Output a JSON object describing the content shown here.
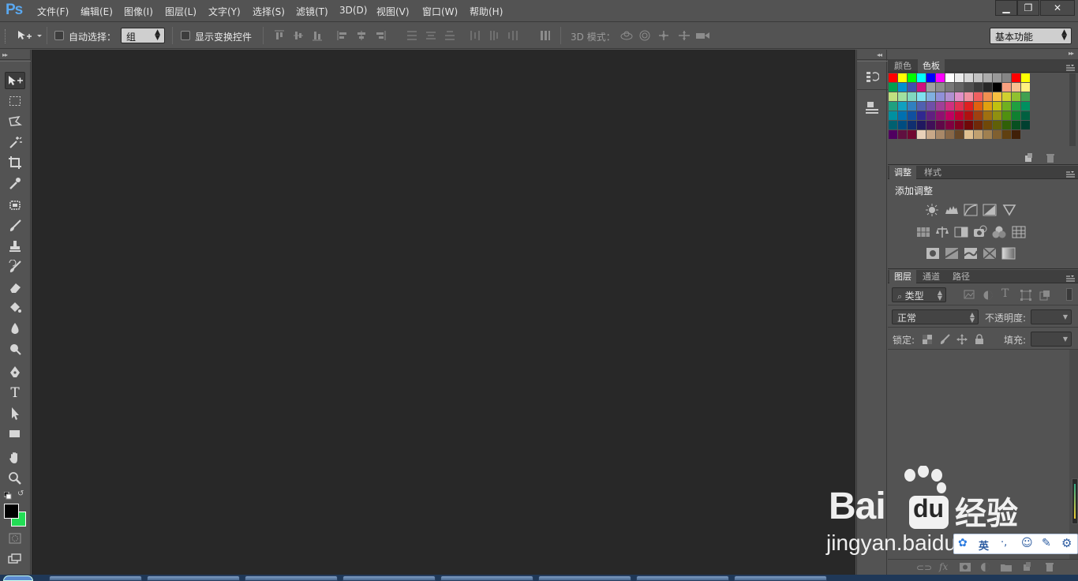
{
  "app": {
    "logo": "Ps"
  },
  "menu": {
    "items": [
      "文件(F)",
      "编辑(E)",
      "图像(I)",
      "图层(L)",
      "文字(Y)",
      "选择(S)",
      "滤镜(T)",
      "3D(D)",
      "视图(V)",
      "窗口(W)",
      "帮助(H)"
    ]
  },
  "window_controls": {
    "minimize": "▁",
    "restore": "❐",
    "close": "✕"
  },
  "options": {
    "auto_select_label": "自动选择：",
    "auto_select_value": "组",
    "show_transform_label": "显示变换控件",
    "mode_3d_label": "3D 模式：",
    "workspace_value": "基本功能"
  },
  "panels": {
    "swatches": {
      "tabs": [
        "颜色",
        "色板"
      ],
      "active_tab": "色板",
      "rows": [
        [
          "#ff0000",
          "#ffff00",
          "#00ff00",
          "#00ffff",
          "#0000ff",
          "#ff00ff",
          "#ffffff",
          "#ebebeb",
          "#d6d6d6",
          "#c2c2c2",
          "#adadad",
          "#999999",
          "#858585",
          "#ff0000",
          "#ffff00"
        ],
        [
          "#00a050",
          "#0090d0",
          "#4050b0",
          "#d01080",
          "#a0a0a0",
          "#8c8c8c",
          "#787878",
          "#646464",
          "#505050",
          "#3c3c3c",
          "#282828",
          "#000000",
          "#f8a080",
          "#f8c090",
          "#fff080"
        ],
        [
          "#c0e080",
          "#a0e0a0",
          "#80d8c0",
          "#80e0f0",
          "#80b0e0",
          "#9090d8",
          "#b090d0",
          "#e090c8",
          "#f090a0",
          "#f06060",
          "#f09050",
          "#f8c040",
          "#d0d030",
          "#90c030",
          "#40a050"
        ],
        [
          "#20a080",
          "#10a0c0",
          "#3080c0",
          "#5060b0",
          "#7050a8",
          "#a04098",
          "#d03080",
          "#e03050",
          "#e02020",
          "#e06010",
          "#e0a010",
          "#c0c010",
          "#70b020",
          "#20a040",
          "#009060"
        ],
        [
          "#0090a0",
          "#0070b0",
          "#1050a0",
          "#302890",
          "#602080",
          "#901070",
          "#c00060",
          "#c00030",
          "#b01010",
          "#a04010",
          "#a07010",
          "#909010",
          "#509010",
          "#108030",
          "#006040"
        ],
        [
          "#006070",
          "#004c80",
          "#102f70",
          "#201860",
          "#401058",
          "#600848",
          "#800040",
          "#800020",
          "#700808",
          "#702808",
          "#704808",
          "#606008",
          "#306008",
          "#085020",
          "#004030"
        ],
        [
          "#500060",
          "#601040",
          "#700830",
          "#e8d0b8",
          "#c8a888",
          "#a88868",
          "#886848",
          "#684828",
          "#e0c090",
          "#c0a070",
          "#a08050",
          "#806030",
          "#604010",
          "#402008"
        ]
      ]
    },
    "adjustments": {
      "tabs": [
        "调整",
        "样式"
      ],
      "active_tab": "调整",
      "heading": "添加调整"
    },
    "layers": {
      "tabs": [
        "图层",
        "通道",
        "路径"
      ],
      "active_tab": "图层",
      "filter_value": "类型",
      "blend_value": "正常",
      "opacity_label": "不透明度:",
      "lock_label": "锁定:",
      "fill_label": "填充:"
    }
  },
  "watermark": {
    "brand": "Bai",
    "brand_suffix": "du",
    "brand_cn": "经验",
    "url": "jingyan.baidu.com"
  },
  "ime": {
    "lang": "英"
  }
}
